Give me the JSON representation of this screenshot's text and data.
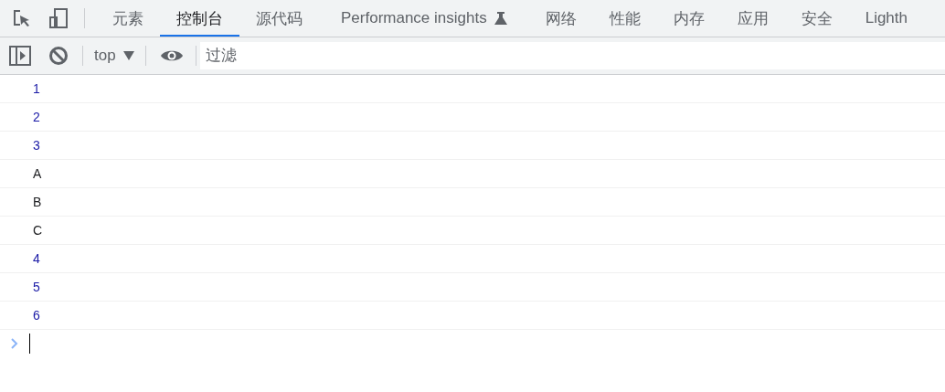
{
  "tabs": [
    {
      "label": "元素",
      "selected": false
    },
    {
      "label": "控制台",
      "selected": true
    },
    {
      "label": "源代码",
      "selected": false
    },
    {
      "label": "Performance insights",
      "selected": false,
      "experimental": true
    },
    {
      "label": "网络",
      "selected": false
    },
    {
      "label": "性能",
      "selected": false
    },
    {
      "label": "内存",
      "selected": false
    },
    {
      "label": "应用",
      "selected": false
    },
    {
      "label": "安全",
      "selected": false
    },
    {
      "label": "Lighth",
      "selected": false
    }
  ],
  "toolbar": {
    "context": "top",
    "filter": {
      "placeholder": "过滤"
    }
  },
  "console": {
    "messages": [
      {
        "text": "1",
        "kind": "number"
      },
      {
        "text": "2",
        "kind": "number"
      },
      {
        "text": "3",
        "kind": "number"
      },
      {
        "text": "A",
        "kind": "string"
      },
      {
        "text": "B",
        "kind": "string"
      },
      {
        "text": "C",
        "kind": "string"
      },
      {
        "text": "4",
        "kind": "number"
      },
      {
        "text": "5",
        "kind": "number"
      },
      {
        "text": "6",
        "kind": "number"
      }
    ]
  }
}
